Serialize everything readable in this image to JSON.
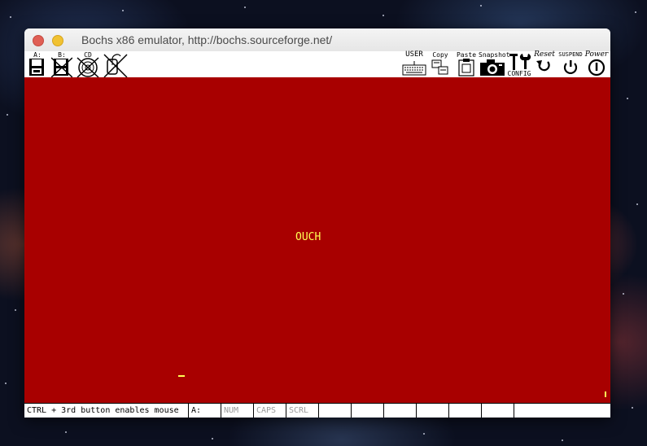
{
  "window": {
    "title": "Bochs x86 emulator, http://bochs.sourceforge.net/"
  },
  "toolbar": {
    "floppy_a_label": "A:",
    "floppy_b_label": "B:",
    "cdrom_label": "CD",
    "user_label": "USER",
    "copy_label": "Copy",
    "paste_label": "Paste",
    "snapshot_label": "Snapshot",
    "config_label": "CONFIG",
    "reset_label": "Reset",
    "suspend_label": "SUSPEND",
    "power_label": "Power"
  },
  "screen": {
    "message": "OUCH",
    "background_color": "#a80000",
    "text_color": "#ffff55"
  },
  "statusbar": {
    "mouse_hint": "CTRL + 3rd button enables mouse",
    "drive_indicator": "A:",
    "num_lock": "NUM",
    "caps_lock": "CAPS",
    "scroll_lock": "SCRL"
  }
}
